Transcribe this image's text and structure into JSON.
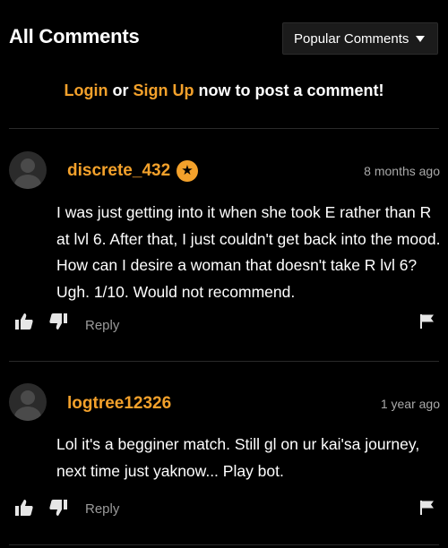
{
  "header": {
    "title": "All Comments",
    "sort_selected": "Popular Comments"
  },
  "login_prompt": {
    "login_label": "Login",
    "or_text": " or ",
    "signup_label": "Sign Up",
    "suffix_text": " now to post a comment!"
  },
  "comments": [
    {
      "username": "discrete_432",
      "has_badge": true,
      "badge_icon": "star-icon",
      "timestamp": "8 months ago",
      "text": "I was just getting into it when she took E rather than R at lvl 6. After that, I just couldn't get back into the mood. How can I desire a woman that doesn't take R lvl 6? Ugh. 1/10. Would not recommend.",
      "reply_label": "Reply"
    },
    {
      "username": "logtree12326",
      "has_badge": false,
      "timestamp": "1 year ago",
      "text": "Lol it's a begginer match. Still gl on ur kai'sa journey, next time just yaknow... Play bot.",
      "reply_label": "Reply"
    }
  ],
  "colors": {
    "background": "#000000",
    "accent": "#f3a12b",
    "text": "#ffffff",
    "muted": "#a9a9a9",
    "dropdown_bg": "#1b1b1b"
  }
}
